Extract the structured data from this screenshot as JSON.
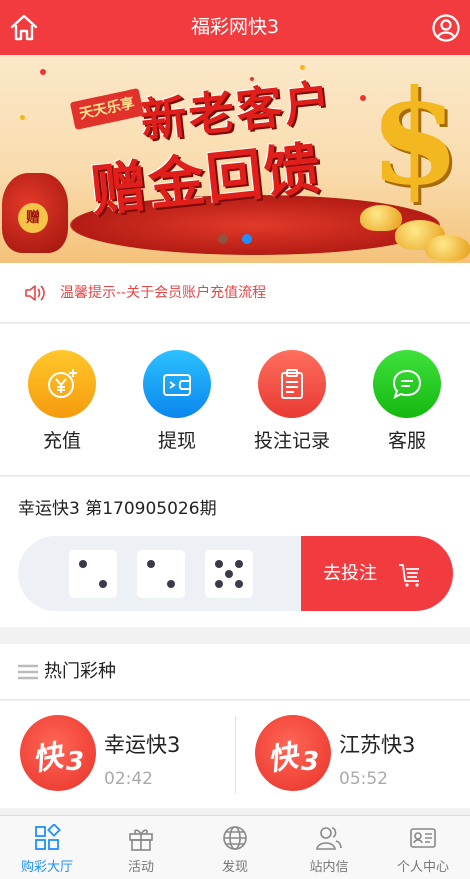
{
  "header": {
    "title": "福彩网快3",
    "home_icon": "home-icon",
    "user_icon": "user-circle-icon",
    "bg": "#f23b3f"
  },
  "banner": {
    "tag": "天天乐享",
    "slogan_line1": "新老客户",
    "slogan_line2": "赠金回馈",
    "bag_label": "赠",
    "dollar": "$",
    "active_slide": 2,
    "slides": 2
  },
  "notice": {
    "icon": "speaker-icon",
    "text": "温馨提示--关于会员账户充值流程"
  },
  "quick_actions": [
    {
      "label": "充值",
      "icon": "yen-coin-icon"
    },
    {
      "label": "提现",
      "icon": "wallet-icon"
    },
    {
      "label": "投注记录",
      "icon": "clipboard-icon"
    },
    {
      "label": "客服",
      "icon": "chat-bubble-icon"
    }
  ],
  "draw": {
    "period": "幸运快3 第170905026期",
    "dice": [
      2,
      2,
      5
    ],
    "bet_label": "去投注",
    "bet_icon": "cart-icon"
  },
  "hot": {
    "title": "热门彩种",
    "items": [
      {
        "logo_text": "快",
        "logo_num": "3",
        "name": "幸运快3",
        "time": "02:42"
      },
      {
        "logo_text": "快",
        "logo_num": "3",
        "name": "江苏快3",
        "time": "05:52"
      }
    ]
  },
  "tabbar": [
    {
      "label": "购彩大厅",
      "icon": "grid-icon",
      "active": true
    },
    {
      "label": "活动",
      "icon": "gift-icon",
      "active": false
    },
    {
      "label": "发现",
      "icon": "globe-icon",
      "active": false
    },
    {
      "label": "站内信",
      "icon": "contacts-icon",
      "active": false
    },
    {
      "label": "个人中心",
      "icon": "id-card-icon",
      "active": false
    }
  ],
  "colors": {
    "accent": "#f23b3f",
    "active_tab": "#1e90ff",
    "notice_text": "#e84545"
  }
}
